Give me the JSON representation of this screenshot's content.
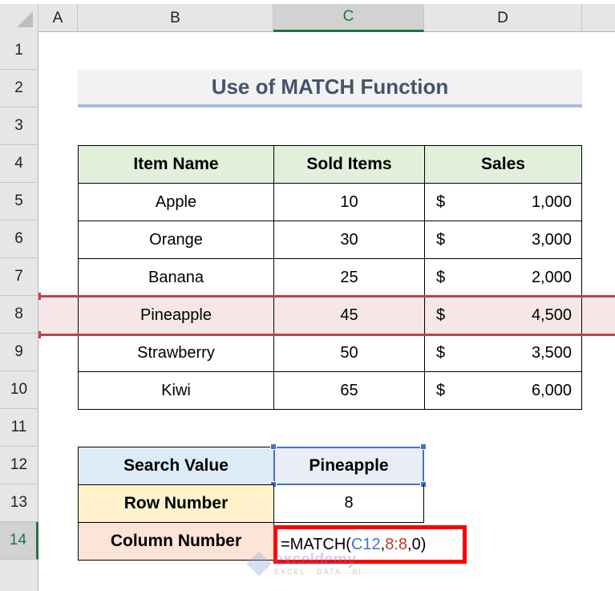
{
  "sheet": {
    "columns": [
      "A",
      "B",
      "C",
      "D"
    ],
    "selected_column": "C",
    "rows": [
      "1",
      "2",
      "3",
      "4",
      "5",
      "6",
      "7",
      "8",
      "9",
      "10",
      "11",
      "12",
      "13",
      "14"
    ],
    "selected_row": "14",
    "highlighted_row": "8"
  },
  "title": "Use of MATCH Function",
  "table": {
    "headers": [
      "Item Name",
      "Sold Items",
      "Sales"
    ],
    "currency_symbol": "$",
    "rows": [
      {
        "item": "Apple",
        "sold": "10",
        "sales": "1,000"
      },
      {
        "item": "Orange",
        "sold": "30",
        "sales": "3,000"
      },
      {
        "item": "Banana",
        "sold": "25",
        "sales": "2,000"
      },
      {
        "item": "Pineapple",
        "sold": "45",
        "sales": "4,500"
      },
      {
        "item": "Strawberry",
        "sold": "50",
        "sales": "3,500"
      },
      {
        "item": "Kiwi",
        "sold": "65",
        "sales": "6,000"
      }
    ]
  },
  "lookup": {
    "search_label": "Search Value",
    "search_value": "Pineapple",
    "row_label": "Row Number",
    "row_value": "8",
    "column_label": "Column Number",
    "formula": {
      "prefix": "=MATCH(",
      "ref1": "C12",
      "sep1": ",",
      "ref2": "8:8",
      "suffix": ",0)"
    }
  },
  "watermark": {
    "name": "exceldemy",
    "tagline": "EXCEL · DATA · BI"
  },
  "colors": {
    "highlight": "#c0404a",
    "selection": "#4472c4",
    "formula_box": "#ff0000",
    "excel_green": "#217346"
  }
}
